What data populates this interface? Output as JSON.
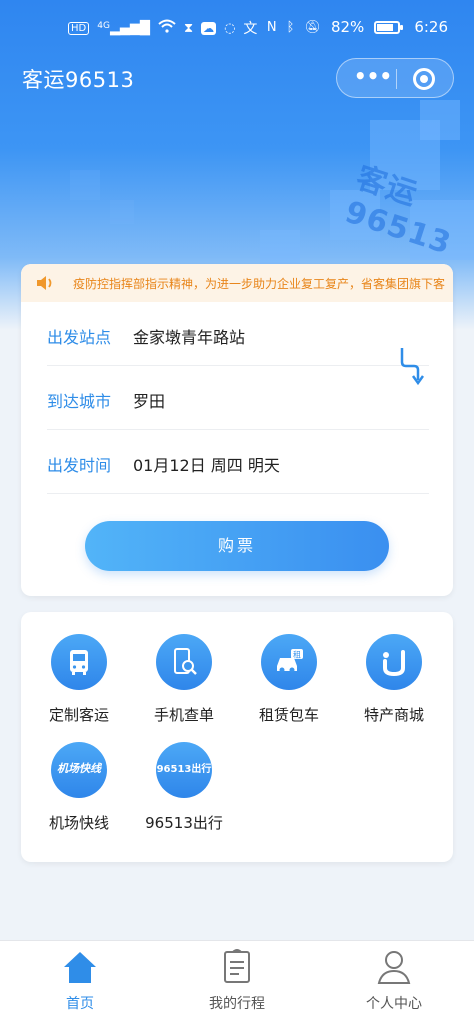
{
  "status_bar": {
    "left_icons": [
      "hd-icon",
      "4g-signal-icon",
      "wifi-icon",
      "hourglass-icon",
      "cloud-icon",
      "chat-icon",
      "translate-icon"
    ],
    "hd": "HD",
    "net": "4G",
    "battery_percent": "82%",
    "battery_level": 0.82,
    "time": "6:26"
  },
  "header": {
    "title": "客运96513",
    "watermark": "客运96513",
    "more_label": "•••"
  },
  "booking": {
    "notice": "疫防控指挥部指示精神，为进一步助力企业复工复产，省客集团旗下客",
    "fields": [
      {
        "label": "出发站点",
        "value": "金家墩青年路站"
      },
      {
        "label": "到达城市",
        "value": "罗田"
      },
      {
        "label": "出发时间",
        "value": "01月12日 周四 明天"
      }
    ],
    "buy_label": "购票"
  },
  "services": [
    {
      "name": "定制客运",
      "icon": "bus-icon"
    },
    {
      "name": "手机查单",
      "icon": "phone-search-icon"
    },
    {
      "name": "租赁包车",
      "icon": "car-rental-icon",
      "badge": "租"
    },
    {
      "name": "特产商城",
      "icon": "mall-icon"
    },
    {
      "name": "机场快线",
      "icon": "airport-express-logo",
      "logo_text": "机场快线"
    },
    {
      "name": "96513出行",
      "icon": "96513-logo",
      "logo_text": "96513出行"
    }
  ],
  "tabs": [
    {
      "label": "首页",
      "icon": "home-icon",
      "active": true
    },
    {
      "label": "我的行程",
      "icon": "itinerary-icon",
      "active": false
    },
    {
      "label": "个人中心",
      "icon": "user-icon",
      "active": false
    }
  ],
  "colors": {
    "primary": "#2f8de8",
    "notice_bg": "#fdf3e6",
    "notice_text": "#e8851a",
    "inactive_tab": "#666666"
  }
}
